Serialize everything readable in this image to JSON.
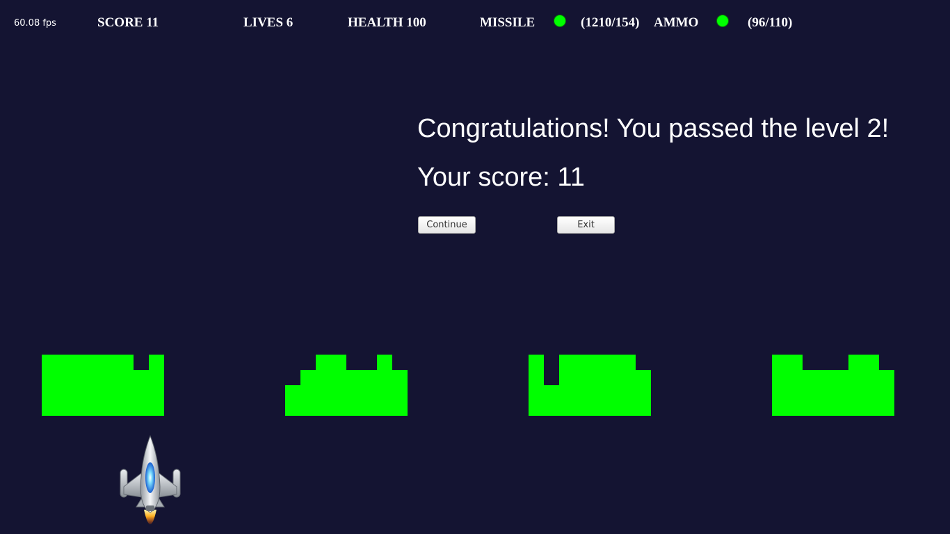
{
  "hud": {
    "fps": "60.08 fps",
    "score": "SCORE 11",
    "lives": "LIVES 6",
    "health": "HEALTH 100",
    "missile_label": "MISSILE",
    "missile_count": "(1210/154)",
    "ammo_label": "AMMO",
    "ammo_count": "(96/110)"
  },
  "indicators": {
    "missile_color": "#00ff00",
    "ammo_color": "#00ff00"
  },
  "dialog": {
    "congrats": "Congratulations! You passed the level 2!",
    "score_text": "Your score: 11",
    "continue_label": "Continue",
    "exit_label": "Exit"
  },
  "colors": {
    "background": "#141432",
    "bunker": "#00ff00"
  },
  "player": {
    "icon": "spaceship-icon"
  }
}
